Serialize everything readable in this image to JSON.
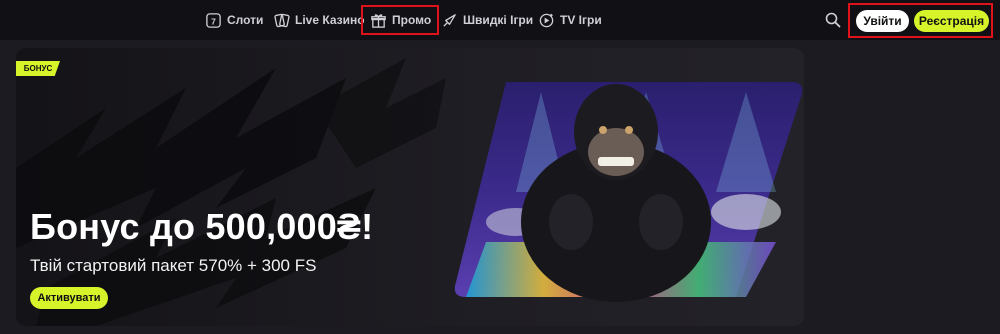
{
  "nav": {
    "items": [
      {
        "label": "Слоти",
        "icon": "slot-machine-icon"
      },
      {
        "label": "Live Казино",
        "icon": "playing-cards-icon"
      },
      {
        "label": "Промо",
        "icon": "gift-icon"
      },
      {
        "label": "Швидкі Ігри",
        "icon": "rocket-icon"
      },
      {
        "label": "TV Ігри",
        "icon": "tv-games-icon"
      }
    ]
  },
  "header": {
    "search_icon": "search-icon",
    "login_label": "Увійти",
    "register_label": "Реєстрація"
  },
  "banner": {
    "badge": "БОНУС",
    "title": "Бонус до 500,000₴!",
    "subtitle": "Твій стартовий пакет 570% + 300 FS",
    "cta_label": "Активувати"
  },
  "colors": {
    "accent": "#d7f42a",
    "highlight_border": "#e0131b",
    "background": "#1c1b22",
    "topbar": "#111015"
  }
}
